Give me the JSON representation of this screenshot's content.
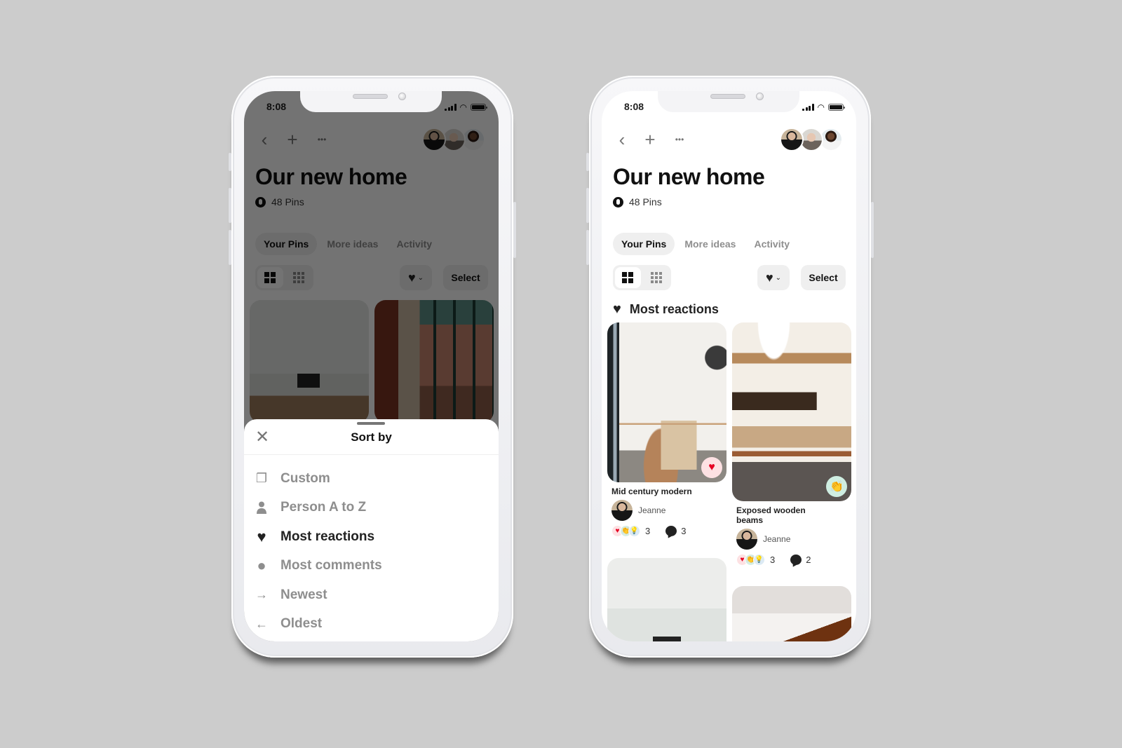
{
  "status_bar": {
    "time": "8:08"
  },
  "board": {
    "title": "Our new home",
    "pin_count": "48 Pins",
    "privacy_icon": "lock-icon"
  },
  "nav": {
    "back_icon": "‹",
    "add_icon": "+",
    "more_icon": "•••"
  },
  "tabs": [
    {
      "label": "Your Pins",
      "active": true
    },
    {
      "label": "More ideas",
      "active": false
    },
    {
      "label": "Activity",
      "active": false
    }
  ],
  "toolbar": {
    "sort_icon": "♥",
    "sort_chevron": "⌄",
    "select_label": "Select",
    "view_modes": [
      "default-grid",
      "compact-grid"
    ],
    "active_view": "default-grid"
  },
  "sort_sheet": {
    "title": "Sort by",
    "close_icon": "✕",
    "options": [
      {
        "label": "Custom",
        "icon": "❐",
        "icon_name": "custom-order-icon",
        "selected": false
      },
      {
        "label": "Person A to Z",
        "icon": "👤",
        "icon_name": "person-icon",
        "selected": false
      },
      {
        "label": "Most reactions",
        "icon": "♥",
        "icon_name": "heart-icon",
        "selected": true
      },
      {
        "label": "Most comments",
        "icon": "●",
        "icon_name": "comment-icon",
        "selected": false
      },
      {
        "label": "Newest",
        "icon": "→",
        "icon_name": "arrow-right-icon",
        "selected": false
      },
      {
        "label": "Oldest",
        "icon": "←",
        "icon_name": "arrow-left-icon",
        "selected": false
      }
    ]
  },
  "section": {
    "icon": "♥",
    "title": "Most reactions"
  },
  "pins": [
    {
      "title": "Mid century modern",
      "user": "Jeanne",
      "reaction_count": "3",
      "comment_count": "3",
      "badge": "♥"
    },
    {
      "title": "Exposed wooden beams",
      "user": "Jeanne",
      "reaction_count": "3",
      "comment_count": "2",
      "badge": "👏"
    }
  ],
  "reaction_icons": {
    "heart": "♥",
    "clap": "👏",
    "idea": "💡"
  },
  "colors": {
    "brand_red": "#e60023",
    "background": "#cccccc",
    "tab_active_bg": "#efefef"
  }
}
